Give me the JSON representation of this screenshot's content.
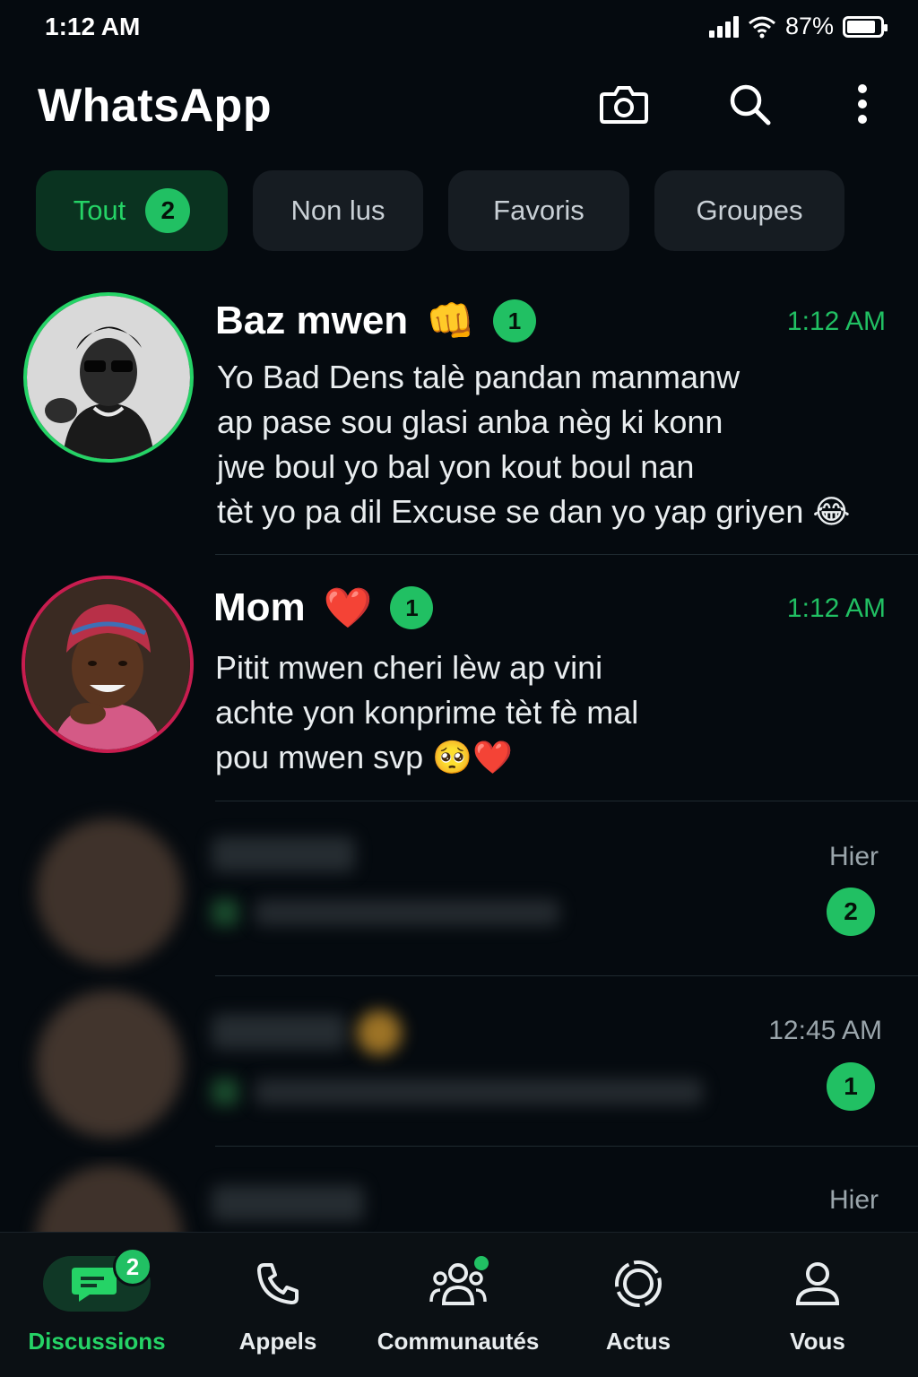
{
  "status_bar": {
    "time": "1:12 AM",
    "battery": "87%",
    "battery_level": 0.87
  },
  "header": {
    "title": "WhatsApp",
    "icons": [
      "camera-icon",
      "search-icon",
      "more-vert-icon"
    ]
  },
  "filters": [
    {
      "label": "Tout",
      "count": "2",
      "active": true
    },
    {
      "label": "Non lus"
    },
    {
      "label": "Favoris"
    },
    {
      "label": "Groupes"
    }
  ],
  "chats": [
    {
      "name": "Baz mwen",
      "emoji": "👊",
      "unread": "1",
      "time": "1:12 AM",
      "message_lines": [
        "Yo Bad Dens talè pandan manmanw",
        "ap pase sou glasi anba nèg ki konn",
        "jwe boul yo bal yon kout boul nan",
        "tèt yo pa dil Excuse se dan yo yap griyen 😂"
      ]
    },
    {
      "name": "Mom",
      "emoji": "❤️",
      "unread": "1",
      "time": "1:12 AM",
      "message_lines": [
        "Pitit mwen cheri lèw ap vini",
        "achte yon konprime tèt fè mal",
        "pou mwen svp 🥺❤️"
      ]
    },
    {
      "time": "Hier",
      "unread": "2"
    },
    {
      "time": "12:45 AM",
      "unread": "1"
    },
    {
      "time": "Hier"
    }
  ],
  "bottom_nav": [
    {
      "label": "Discussions",
      "badge": "2",
      "active": true
    },
    {
      "label": "Appels"
    },
    {
      "label": "Communautés"
    },
    {
      "label": "Actus"
    },
    {
      "label": "Vous"
    }
  ],
  "colors": {
    "accent": "#21c063",
    "background": "#050a0f",
    "text": "#e9edef",
    "muted": "#9aa5ab"
  }
}
